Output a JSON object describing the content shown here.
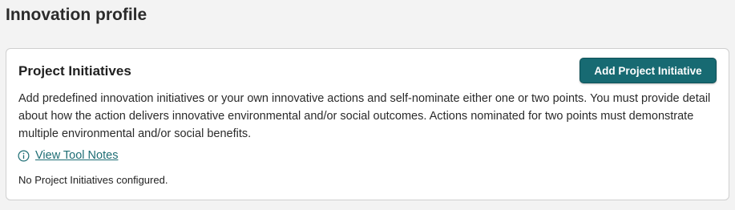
{
  "page": {
    "title": "Innovation profile"
  },
  "card": {
    "title": "Project Initiatives",
    "add_button_label": "Add Project Initiative",
    "description": "Add predefined innovation initiatives or your own innovative actions and self-nominate either one or two points. You must provide detail about how the action delivers innovative environmental and/or social outcomes. Actions nominated for two points must demonstrate multiple environmental and/or social benefits.",
    "tool_notes_link": "View Tool Notes",
    "tool_notes_icon": "info-icon",
    "empty_message": "No Project Initiatives configured."
  },
  "colors": {
    "accent": "#176a72",
    "link": "#1d6d74",
    "background": "#f3f3f3",
    "card_border": "#cfcfcf"
  }
}
